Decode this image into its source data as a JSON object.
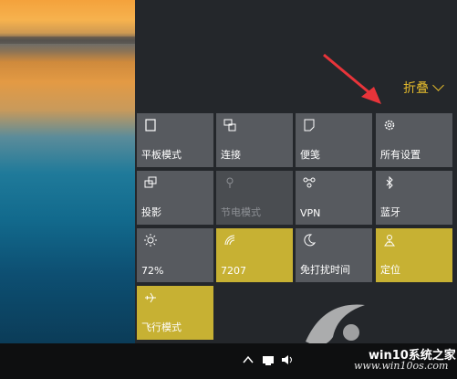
{
  "collapse_label": "折叠",
  "tiles": [
    {
      "label": "平板模式",
      "icon": "tablet-mode-icon",
      "state": "default"
    },
    {
      "label": "连接",
      "icon": "connect-icon",
      "state": "default"
    },
    {
      "label": "便笺",
      "icon": "note-icon",
      "state": "default"
    },
    {
      "label": "所有设置",
      "icon": "gear-icon",
      "state": "default"
    },
    {
      "label": "投影",
      "icon": "project-icon",
      "state": "default"
    },
    {
      "label": "节电模式",
      "icon": "battery-saver-icon",
      "state": "disabled"
    },
    {
      "label": "VPN",
      "icon": "vpn-icon",
      "state": "default"
    },
    {
      "label": "蓝牙",
      "icon": "bluetooth-icon",
      "state": "default"
    },
    {
      "label": "72%",
      "icon": "brightness-icon",
      "state": "default"
    },
    {
      "label": "7207",
      "icon": "wifi-icon",
      "state": "on"
    },
    {
      "label": "免打扰时间",
      "icon": "moon-icon",
      "state": "default"
    },
    {
      "label": "定位",
      "icon": "location-icon",
      "state": "on"
    },
    {
      "label": "飞行模式",
      "icon": "airplane-icon",
      "state": "on"
    }
  ],
  "watermark": {
    "title": "win10系统之家",
    "url": "www.win10os.com"
  },
  "colors": {
    "accent": "#c7b133",
    "tile": "#575a5f",
    "panel": "#24272b",
    "arrow": "#e8343a"
  }
}
